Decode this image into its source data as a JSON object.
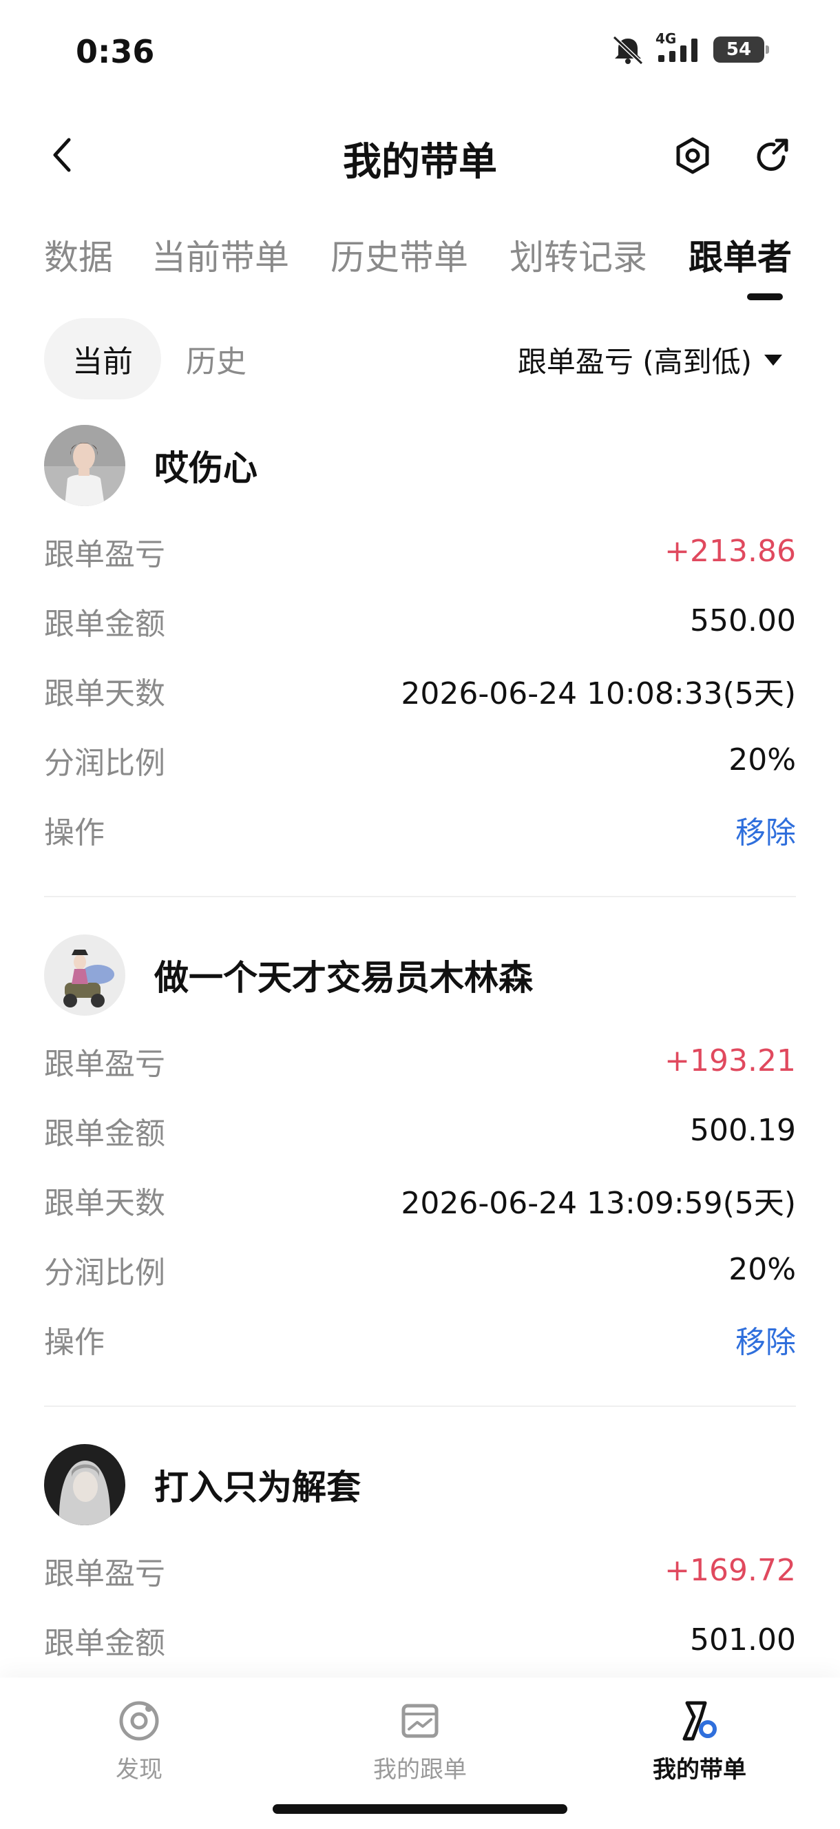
{
  "status_bar": {
    "time": "0:36",
    "network": "4G",
    "battery": "54",
    "icons": [
      "mute-icon",
      "signal-icon",
      "battery-icon"
    ]
  },
  "header": {
    "title": "我的带单",
    "icons": [
      "back-icon",
      "settings-icon",
      "share-icon"
    ]
  },
  "tabs": [
    {
      "label": "数据"
    },
    {
      "label": "当前带单"
    },
    {
      "label": "历史带单"
    },
    {
      "label": "划转记录"
    },
    {
      "label": "跟单者"
    }
  ],
  "active_tab": "跟单者",
  "filter": {
    "chips": [
      {
        "label": "当前"
      },
      {
        "label": "历史"
      }
    ],
    "active_chip": "当前",
    "sort_label": "跟单盈亏 (高到低)"
  },
  "row_labels": {
    "profit": "跟单盈亏",
    "amount": "跟单金额",
    "days": "跟单天数",
    "share": "分润比例",
    "action": "操作"
  },
  "followers": [
    {
      "name": "哎伤心",
      "profit": "+213.86",
      "amount": "550.00",
      "days": "2026-06-24 10:08:33(5天)",
      "share": "20%",
      "action": "移除"
    },
    {
      "name": "做一个天才交易员木林森",
      "profit": "+193.21",
      "amount": "500.19",
      "days": "2026-06-24 13:09:59(5天)",
      "share": "20%",
      "action": "移除"
    },
    {
      "name": "打入只为解套",
      "profit": "+169.72",
      "amount": "501.00"
    }
  ],
  "bottom_nav": [
    {
      "label": "发现",
      "icon": "discover-icon"
    },
    {
      "label": "我的跟单",
      "icon": "chart-box-icon"
    },
    {
      "label": "我的带单",
      "icon": "leader-icon"
    }
  ],
  "colors": {
    "profit": "#e0495e",
    "action": "#2f6fdc",
    "muted": "#8a8a8a"
  }
}
